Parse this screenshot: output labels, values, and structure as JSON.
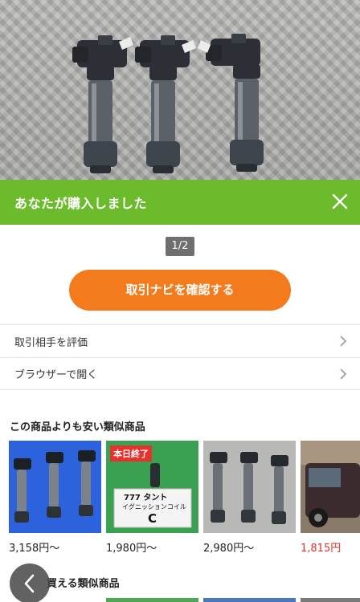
{
  "banner": {
    "title": "あなたが購入しました",
    "close_icon": "close-icon"
  },
  "pager": "1/2",
  "cta_label": "取引ナビを確認する",
  "menu": [
    {
      "label": "取引相手を評価"
    },
    {
      "label": "ブラウザーで開く"
    }
  ],
  "similar": {
    "title": "この商品よりも安い類似商品",
    "items": [
      {
        "price": "3,158円〜"
      },
      {
        "price": "1,980円〜",
        "badge": "本日終了",
        "sign_line1": "777 タント",
        "sign_line2": "イグニッションコイル",
        "sign_letter": "C"
      },
      {
        "price": "2,980円〜"
      },
      {
        "price": "1,815円"
      }
    ]
  },
  "section2_title": "買える類似商品",
  "colors": {
    "banner": "#6cbb2c",
    "cta": "#f37b1d",
    "badge": "#e8302c",
    "sale_price": "#e0332b"
  }
}
